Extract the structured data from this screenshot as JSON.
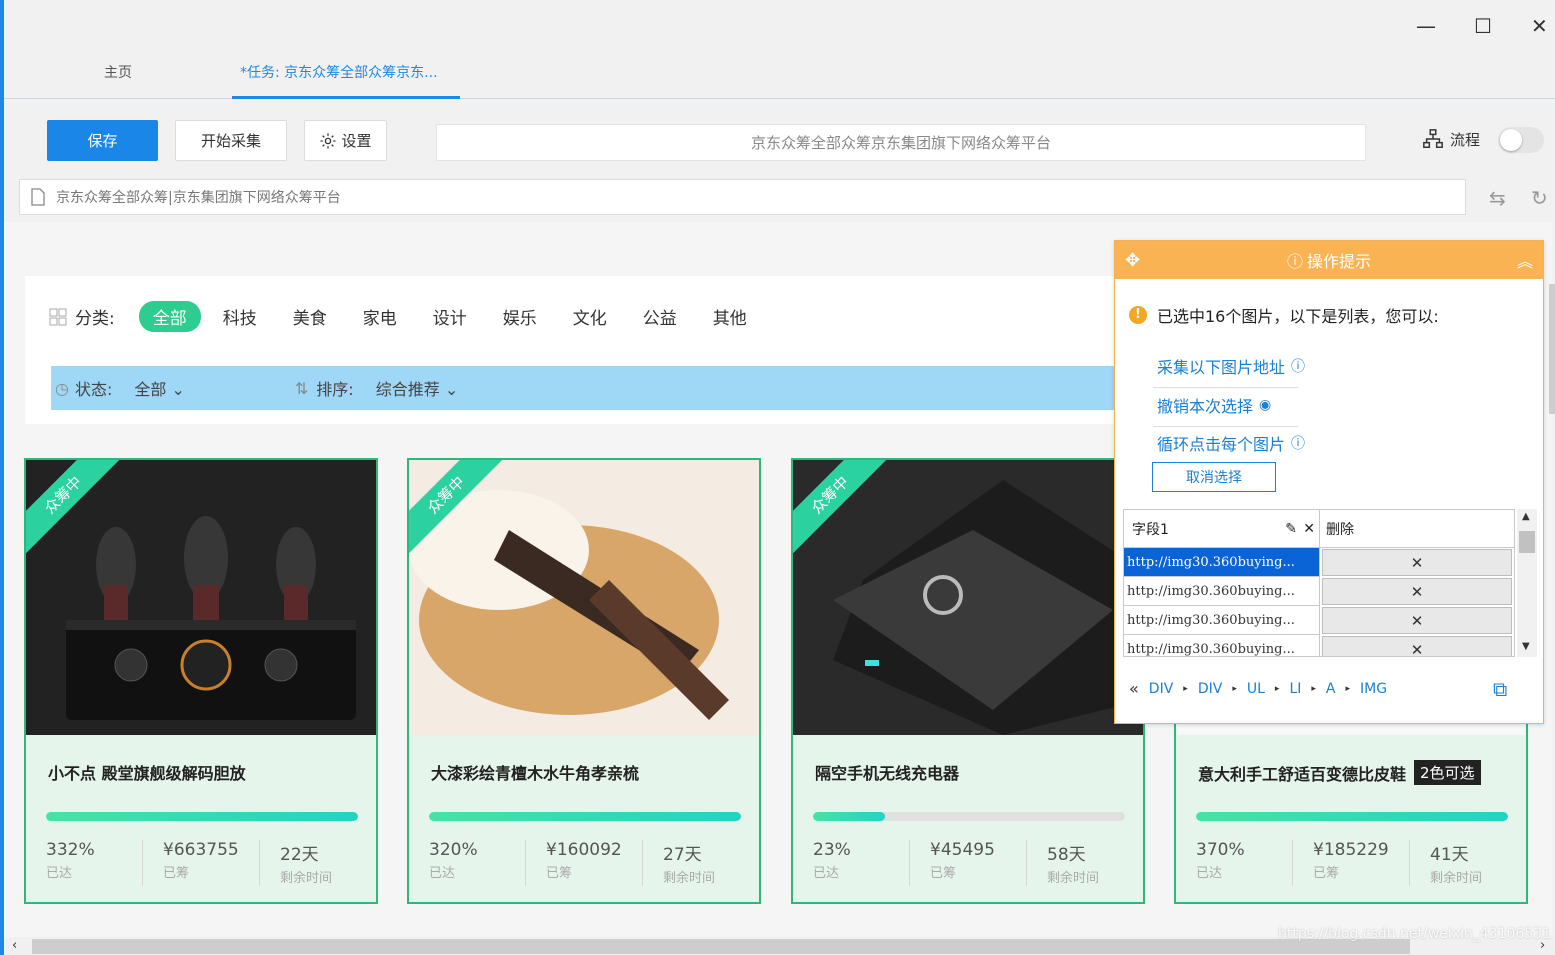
{
  "window": {
    "minimize": "—",
    "maximize": "☐",
    "close": "✕"
  },
  "tabs": [
    {
      "label": "主页"
    },
    {
      "label": "*任务: 京东众筹全部众筹京东..."
    }
  ],
  "toolbar": {
    "save_label": "保存",
    "start_label": "开始采集",
    "settings_label": "设置",
    "page_title": "京东众筹全部众筹京东集团旗下网络众筹平台",
    "flow_label": "流程"
  },
  "address_bar": {
    "value": "京东众筹全部众筹|京东集团旗下网络众筹平台"
  },
  "filters": {
    "category_label": "分类:",
    "categories": [
      "全部",
      "科技",
      "美食",
      "家电",
      "设计",
      "娱乐",
      "文化",
      "公益",
      "其他"
    ],
    "status_label": "状态:",
    "status_value": "全部",
    "sort_label": "排序:",
    "sort_value": "综合推荐"
  },
  "products": [
    {
      "ribbon": "众筹中",
      "name": "小不点 殿堂旗舰级解码胆放",
      "badge": "",
      "progress": 1.0,
      "percent": "332%",
      "percent_label": "已达",
      "amount": "¥663755",
      "amount_label": "已筹",
      "days": "22天",
      "days_label": "剩余时间"
    },
    {
      "ribbon": "众筹中",
      "name": "大漆彩绘青檀木水牛角孝亲梳",
      "badge": "",
      "progress": 1.0,
      "percent": "320%",
      "percent_label": "已达",
      "amount": "¥160092",
      "amount_label": "已筹",
      "days": "27天",
      "days_label": "剩余时间"
    },
    {
      "ribbon": "众筹中",
      "name": "隔空手机无线充电器",
      "badge": "",
      "progress": 0.23,
      "percent": "23%",
      "percent_label": "已达",
      "amount": "¥45495",
      "amount_label": "已筹",
      "days": "58天",
      "days_label": "剩余时间"
    },
    {
      "ribbon": "",
      "name": "意大利手工舒适百变德比皮鞋",
      "badge": "2色可选",
      "progress": 1.0,
      "percent": "370%",
      "percent_label": "已达",
      "amount": "¥185229",
      "amount_label": "已筹",
      "days": "41天",
      "days_label": "剩余时间"
    }
  ],
  "hint_panel": {
    "title": "操作提示",
    "message": "已选中16个图片，以下是列表，您可以:",
    "actions": [
      "采集以下图片地址",
      "撤销本次选择",
      "循环点击每个图片"
    ],
    "cancel_label": "取消选择",
    "field_header": "字段1",
    "delete_header": "删除",
    "rows": [
      "http://img30.360buying...",
      "http://img30.360buying...",
      "http://img30.360buying...",
      "http://img30.360buying..."
    ],
    "crumbs": [
      "DIV",
      "DIV",
      "UL",
      "LI",
      "A",
      "IMG"
    ]
  },
  "watermark": "https://blog.csdn.net/weixin_43106531"
}
